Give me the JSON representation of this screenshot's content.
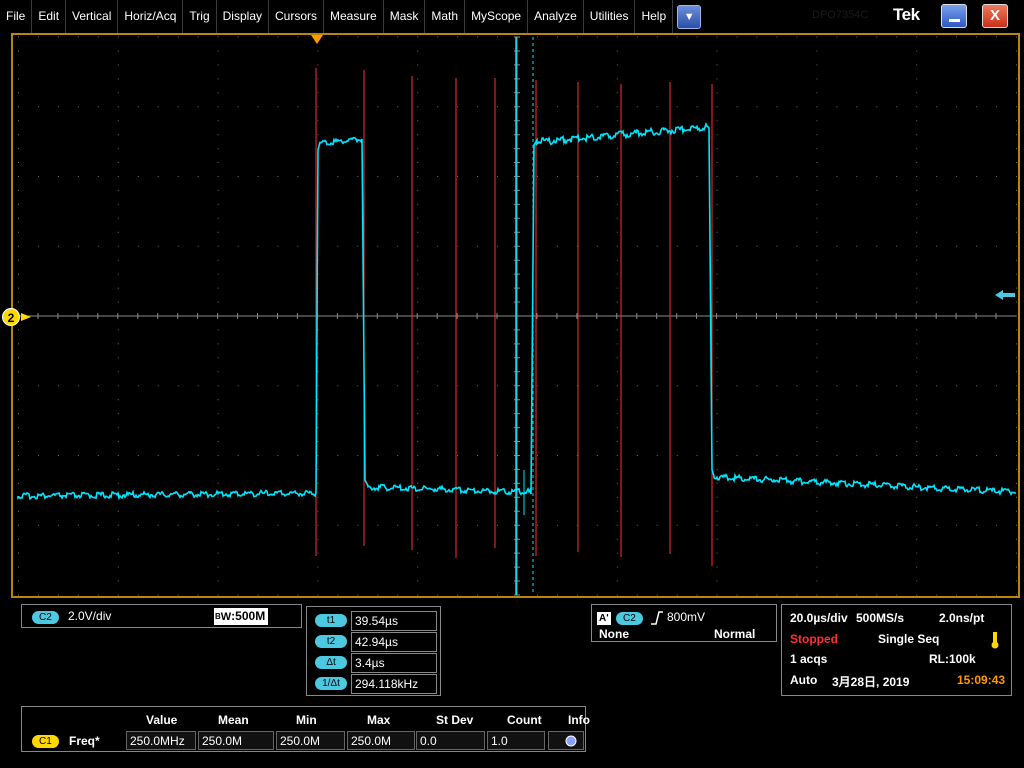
{
  "menu": {
    "items": [
      "File",
      "Edit",
      "Vertical",
      "Horiz/Acq",
      "Trig",
      "Display",
      "Cursors",
      "Measure",
      "Mask",
      "Math",
      "MyScope",
      "Analyze",
      "Utilities",
      "Help"
    ],
    "dropdown_glyph": "▼"
  },
  "window": {
    "brand": "Tek",
    "close_glyph": "X",
    "model": "DPO7354C"
  },
  "scope": {
    "channel_marker": "2",
    "colors": {
      "trace": "#00e5ff",
      "cursors": "#ff3030",
      "grid": "#6b6b6b",
      "frame": "#b8860b",
      "marker": "#ffd700"
    }
  },
  "channel_panel": {
    "badge": "C2",
    "scale": "2.0V/div",
    "bw_prefix": "B",
    "bw_sub": "W",
    "bw_value": ":500M"
  },
  "cursor_panel": {
    "rows": [
      {
        "label": "t1",
        "value": "39.54µs"
      },
      {
        "label": "t2",
        "value": "42.94µs"
      },
      {
        "label": "Δt",
        "value": "3.4µs"
      },
      {
        "label": "1/Δt",
        "value": "294.118kHz"
      }
    ]
  },
  "trigger_panel": {
    "type_badge": "A'",
    "source_badge": "C2",
    "slope_icon": "rising-edge-icon",
    "level": "800mV",
    "coupling": "None",
    "mode": "Normal"
  },
  "acq_panel": {
    "horizontal": "20.0µs/div",
    "sample_rate": "500MS/s",
    "resolution": "2.0ns/pt",
    "state": "Stopped",
    "acq_mode": "Single Seq",
    "acqs": "1 acqs",
    "record_length": "RL:100k",
    "trigger_mode": "Auto",
    "date": "3月28日, 2019",
    "time": "15:09:43"
  },
  "measure_panel": {
    "headers": [
      "Value",
      "Mean",
      "Min",
      "Max",
      "St Dev",
      "Count",
      "Info"
    ],
    "rows": [
      {
        "badge": "C1",
        "name": "Freq*",
        "cells": [
          "250.0MHz",
          "250.0M",
          "250.0M",
          "250.0M",
          "0.0",
          "1.0"
        ]
      }
    ]
  }
}
